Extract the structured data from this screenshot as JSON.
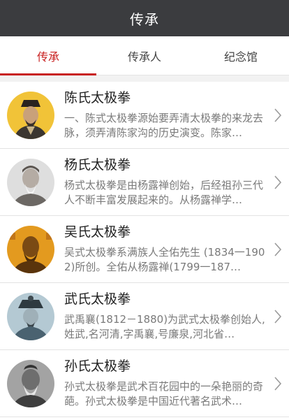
{
  "header": {
    "title": "传承"
  },
  "tabs": [
    {
      "label": "传承",
      "active": true
    },
    {
      "label": "传承人",
      "active": false
    },
    {
      "label": "纪念馆",
      "active": false
    }
  ],
  "items": [
    {
      "title": "陈氏太极拳",
      "desc": "一、陈式太极拳源始要弄清太极拳的来龙去脉，须弄清陈家沟的历史演变。陈家…",
      "avatar_icon": "portrait-chen-icon",
      "bg": "#f1c338"
    },
    {
      "title": "杨氏太极拳",
      "desc": "杨式太极拳是由杨露禅创始，后经祖孙三代人不断丰富发展起来的。从杨露禅学…",
      "avatar_icon": "portrait-yang-icon",
      "bg": "#d9d9d9"
    },
    {
      "title": "吴氏太极拳",
      "desc": "吴式太极拳系满族人全佑先生 (1834一1902)所创。全佑从杨露禅(1799一187…",
      "avatar_icon": "portrait-wu-icon",
      "bg": "#e39a1f"
    },
    {
      "title": "武氏太极拳",
      "desc": "武禹襄(1812－1880)为武式太极拳创始人,姓武,名河清,字禹襄,号廉泉,河北省…",
      "avatar_icon": "portrait-wu2-icon",
      "bg": "#a9c3cf"
    },
    {
      "title": "孙氏太极拳",
      "desc": "孙式太极拳是武术百花园中的一朵艳丽的奇葩。孙式太极拳是中国近代著名武术…",
      "avatar_icon": "portrait-sun-icon",
      "bg": "#9a9a9a"
    }
  ]
}
